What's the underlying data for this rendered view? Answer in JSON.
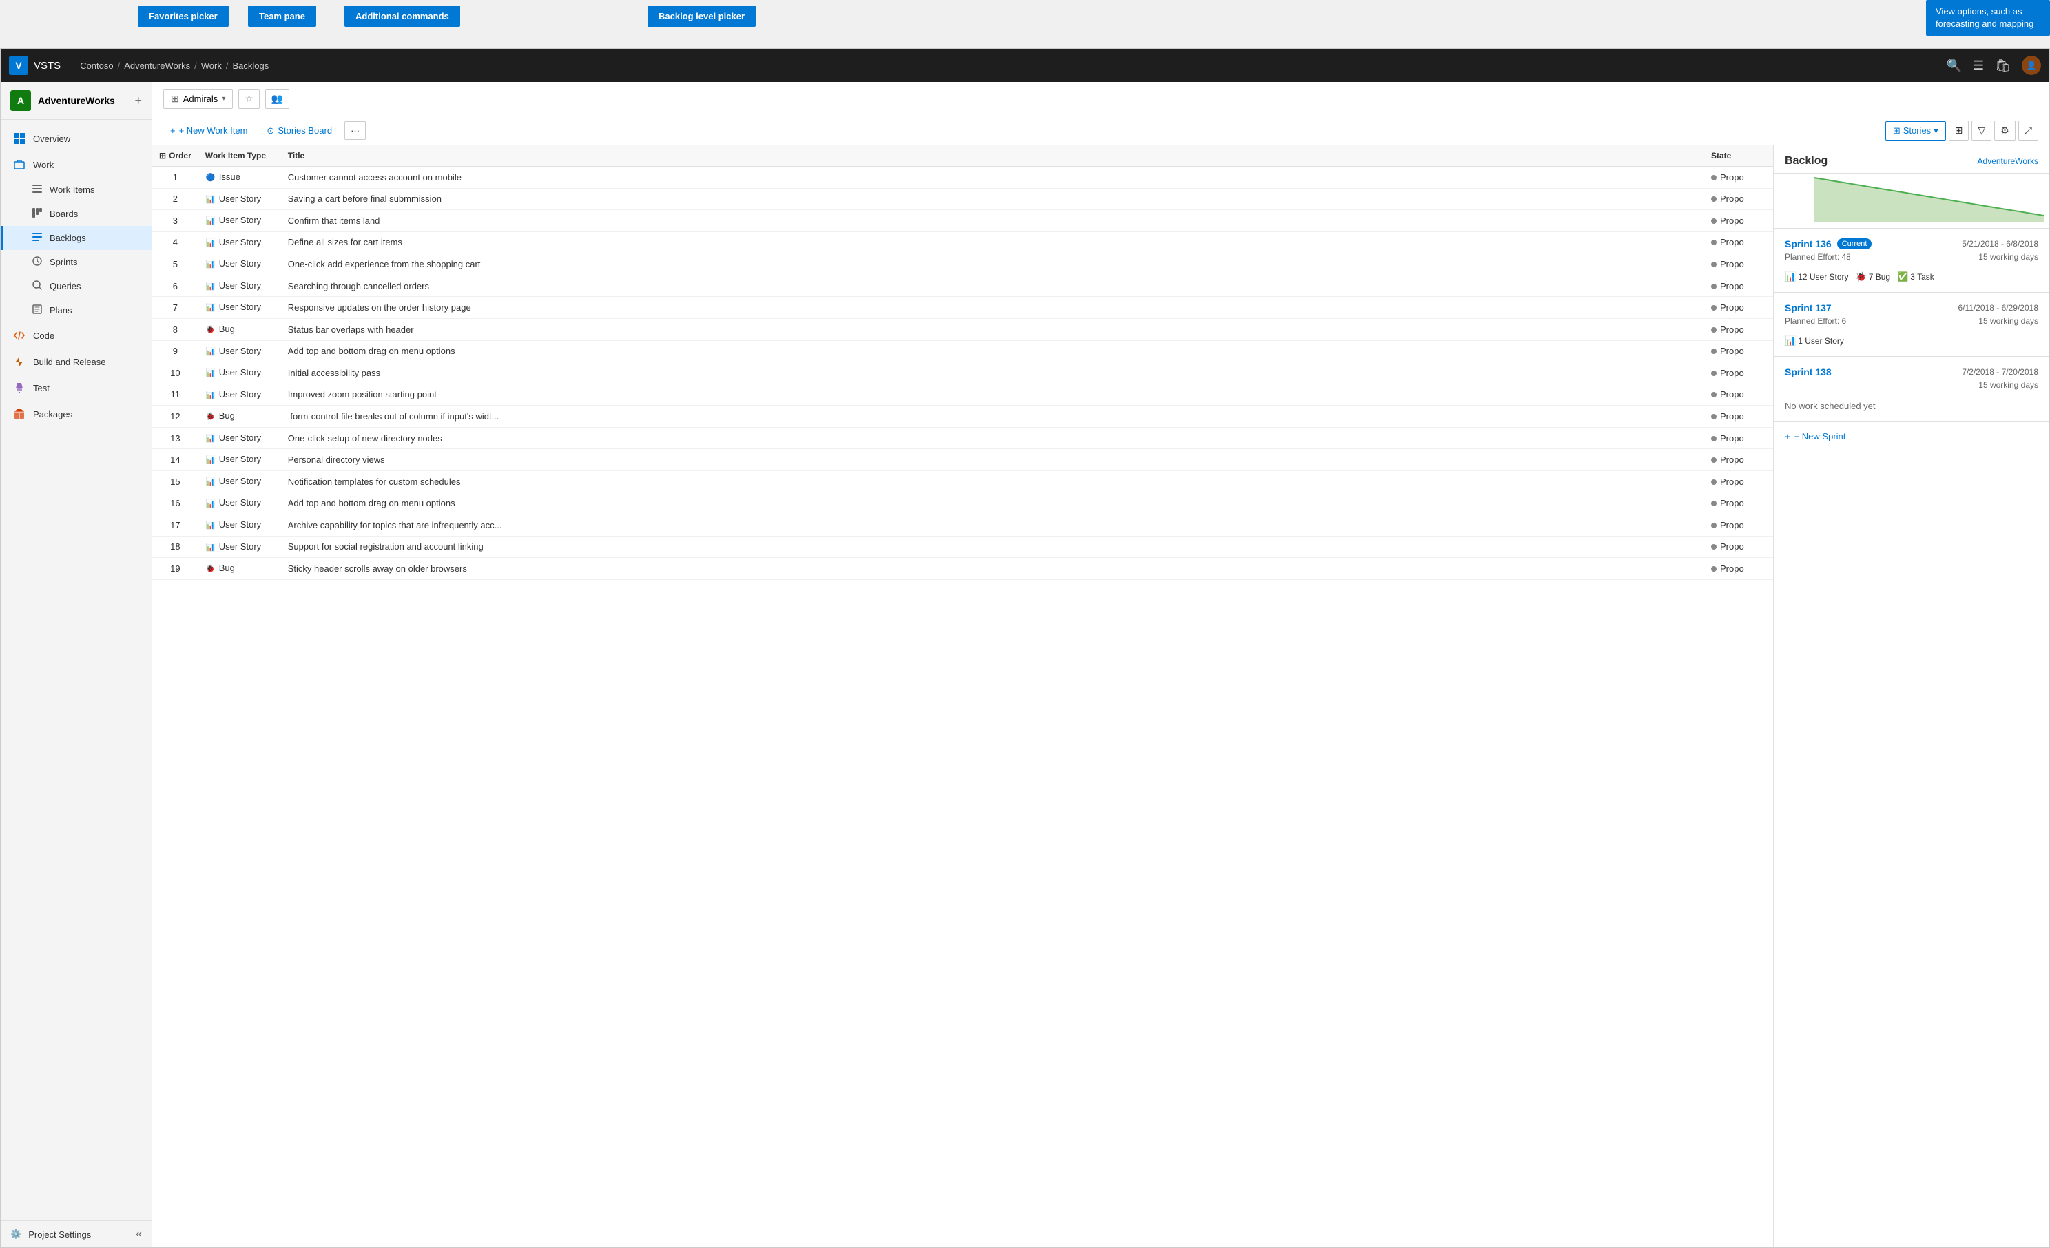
{
  "annotations": {
    "favorites_picker": "Favorites picker",
    "team_pane": "Team pane",
    "additional_commands": "Additional commands",
    "backlog_level_picker": "Backlog level picker",
    "view_options": "View options, such as forecasting and mapping"
  },
  "app": {
    "logo": "V",
    "title": "VSTS"
  },
  "breadcrumb": {
    "parts": [
      "Contoso",
      "AdventureWorks",
      "Work",
      "Backlogs"
    ]
  },
  "sidebar": {
    "project_name": "AdventureWorks",
    "project_initial": "A",
    "nav_items": [
      {
        "id": "overview",
        "label": "Overview",
        "icon": "grid"
      },
      {
        "id": "work",
        "label": "Work",
        "icon": "briefcase",
        "expanded": true
      },
      {
        "id": "work-items",
        "label": "Work Items",
        "icon": "list",
        "sub": true
      },
      {
        "id": "boards",
        "label": "Boards",
        "icon": "board",
        "sub": true
      },
      {
        "id": "backlogs",
        "label": "Backlogs",
        "icon": "backlogs",
        "sub": true,
        "active": true
      },
      {
        "id": "sprints",
        "label": "Sprints",
        "icon": "sprints",
        "sub": true
      },
      {
        "id": "queries",
        "label": "Queries",
        "icon": "queries",
        "sub": true
      },
      {
        "id": "plans",
        "label": "Plans",
        "icon": "plans",
        "sub": true
      },
      {
        "id": "code",
        "label": "Code",
        "icon": "code"
      },
      {
        "id": "build-release",
        "label": "Build and Release",
        "icon": "rocket"
      },
      {
        "id": "test",
        "label": "Test",
        "icon": "beaker"
      },
      {
        "id": "packages",
        "label": "Packages",
        "icon": "package"
      }
    ],
    "footer": {
      "label": "Project Settings",
      "icon": "gear"
    }
  },
  "toolbar": {
    "team_name": "Admirals",
    "new_work_item": "+ New Work Item",
    "stories_board": "Stories Board",
    "more_label": "···",
    "stories_label": "Stories",
    "col_order": "Order",
    "col_type": "Work Item Type",
    "col_title": "Title",
    "col_state": "State"
  },
  "backlog_items": [
    {
      "order": 1,
      "type": "Issue",
      "type_class": "issue",
      "title": "Customer cannot access account on mobile",
      "state": "Propo"
    },
    {
      "order": 2,
      "type": "User Story",
      "type_class": "story",
      "title": "Saving a cart before final submmission",
      "state": "Propo"
    },
    {
      "order": 3,
      "type": "User Story",
      "type_class": "story",
      "title": "Confirm that items land",
      "state": "Propo"
    },
    {
      "order": 4,
      "type": "User Story",
      "type_class": "story",
      "title": "Define all sizes for cart items",
      "state": "Propo"
    },
    {
      "order": 5,
      "type": "User Story",
      "type_class": "story",
      "title": "One-click add experience from the shopping cart",
      "state": "Propo"
    },
    {
      "order": 6,
      "type": "User Story",
      "type_class": "story",
      "title": "Searching through cancelled orders",
      "state": "Propo"
    },
    {
      "order": 7,
      "type": "User Story",
      "type_class": "story",
      "title": "Responsive updates on the order history page",
      "state": "Propo"
    },
    {
      "order": 8,
      "type": "Bug",
      "type_class": "bug",
      "title": "Status bar overlaps with header",
      "state": "Propo"
    },
    {
      "order": 9,
      "type": "User Story",
      "type_class": "story",
      "title": "Add top and bottom drag on menu options",
      "state": "Propo"
    },
    {
      "order": 10,
      "type": "User Story",
      "type_class": "story",
      "title": "Initial accessibility pass",
      "state": "Propo"
    },
    {
      "order": 11,
      "type": "User Story",
      "type_class": "story",
      "title": "Improved zoom position starting point",
      "state": "Propo"
    },
    {
      "order": 12,
      "type": "Bug",
      "type_class": "bug",
      "title": ".form-control-file breaks out of column if input's widt...",
      "state": "Propo"
    },
    {
      "order": 13,
      "type": "User Story",
      "type_class": "story",
      "title": "One-click setup of new directory nodes",
      "state": "Propo"
    },
    {
      "order": 14,
      "type": "User Story",
      "type_class": "story",
      "title": "Personal directory views",
      "state": "Propo"
    },
    {
      "order": 15,
      "type": "User Story",
      "type_class": "story",
      "title": "Notification templates for custom schedules",
      "state": "Propo"
    },
    {
      "order": 16,
      "type": "User Story",
      "type_class": "story",
      "title": "Add top and bottom drag on menu options",
      "state": "Propo"
    },
    {
      "order": 17,
      "type": "User Story",
      "type_class": "story",
      "title": "Archive capability for topics that are infrequently acc...",
      "state": "Propo"
    },
    {
      "order": 18,
      "type": "User Story",
      "type_class": "story",
      "title": "Support for social registration and account linking",
      "state": "Propo"
    },
    {
      "order": 19,
      "type": "Bug",
      "type_class": "bug",
      "title": "Sticky header scrolls away on older browsers",
      "state": "Propo"
    }
  ],
  "backlog_panel": {
    "title": "Backlog",
    "subtitle": "AdventureWorks",
    "sprints": [
      {
        "name": "Sprint 136",
        "current": true,
        "current_label": "Current",
        "dates": "5/21/2018 - 6/8/2018",
        "planned_effort_label": "Planned Effort:",
        "planned_effort": "48",
        "working_days": "15 working days",
        "tags": [
          {
            "icon": "story",
            "count": "12",
            "label": "User Story"
          },
          {
            "icon": "bug",
            "count": "7",
            "label": "Bug"
          },
          {
            "icon": "task",
            "count": "3",
            "label": "Task"
          }
        ]
      },
      {
        "name": "Sprint 137",
        "current": false,
        "dates": "6/11/2018 - 6/29/2018",
        "planned_effort_label": "Planned Effort:",
        "planned_effort": "6",
        "working_days": "15 working days",
        "tags": [
          {
            "icon": "story",
            "count": "1",
            "label": "User Story"
          }
        ]
      },
      {
        "name": "Sprint 138",
        "current": false,
        "dates": "7/2/2018 - 7/20/2018",
        "planned_effort_label": "",
        "planned_effort": "",
        "working_days": "15 working days",
        "no_work": "No work scheduled yet",
        "tags": []
      }
    ],
    "new_sprint_label": "+ New Sprint"
  }
}
